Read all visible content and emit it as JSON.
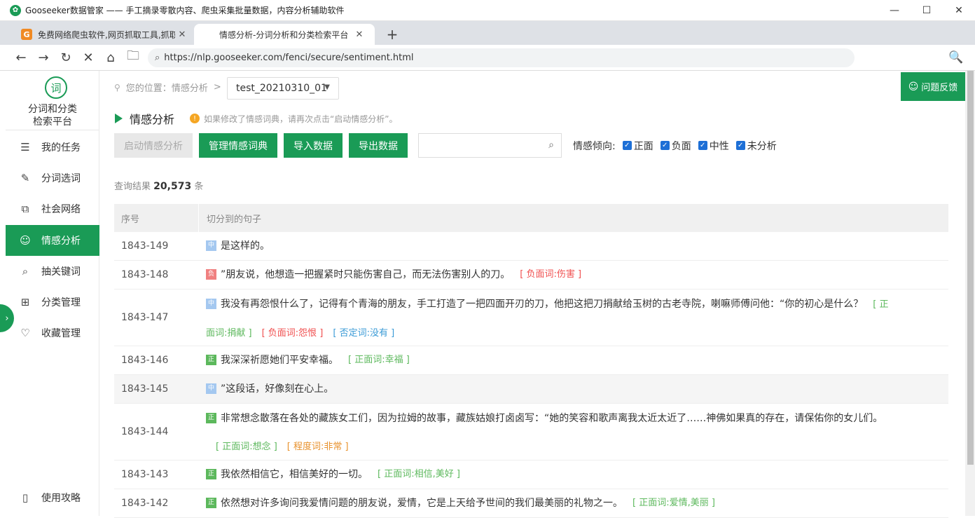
{
  "window": {
    "title": "Gooseeker数据管家 —— 手工摘录零散内容、爬虫采集批量数据，内容分析辅助软件",
    "min_glyph": "—",
    "max_glyph": "☐",
    "close_glyph": "✕"
  },
  "tabs": [
    {
      "favicon": "G",
      "title": "免费网络爬虫软件,网页抓取工具,抓取",
      "close": "✕"
    },
    {
      "title": "情感分析-分词分析和分类检索平台",
      "close": "✕"
    }
  ],
  "new_tab_glyph": "+",
  "nav": {
    "back": "←",
    "forward": "→",
    "reload": "↻",
    "stop": "✕",
    "home": "⌂",
    "folder": "🗀",
    "url": "https://nlp.gooseeker.com/fenci/secure/sentiment.html",
    "search_glyph": "🔍"
  },
  "sidebar": {
    "logo_char": "词",
    "title_line1": "分词和分类",
    "title_line2": "检索平台",
    "items": [
      {
        "label": "我的任务",
        "icon": "☰"
      },
      {
        "label": "分词选词",
        "icon": "✎"
      },
      {
        "label": "社会网络",
        "icon": "⧉"
      },
      {
        "label": "情感分析",
        "icon": "☺"
      },
      {
        "label": "抽关键词",
        "icon": "⌕"
      },
      {
        "label": "分类管理",
        "icon": "⊞"
      },
      {
        "label": "收藏管理",
        "icon": "♡"
      }
    ],
    "bottom_item": {
      "label": "使用攻略",
      "icon": "▯"
    },
    "toggle_glyph": "›"
  },
  "breadcrumb": {
    "prefix": "您的位置：",
    "current": "情感分析",
    "arrow": ">"
  },
  "project_select": {
    "value": "test_20210310_01"
  },
  "feedback_button": "问题反馈",
  "section": {
    "title": "情感分析",
    "hint_icon": "!",
    "hint": "如果修改了情感词典，请再次点击“启动情感分析”。"
  },
  "toolbar": {
    "start_button": "启动情感分析",
    "manage_button": "管理情感词典",
    "import_button": "导入数据",
    "export_button": "导出数据",
    "search_placeholder": "",
    "filter_label": "情感倾向:",
    "filters": [
      {
        "label": "正面",
        "checked": true
      },
      {
        "label": "负面",
        "checked": true
      },
      {
        "label": "中性",
        "checked": true
      },
      {
        "label": "未分析",
        "checked": true
      }
    ]
  },
  "results": {
    "label": "查询结果",
    "count": "20,573",
    "unit": "条"
  },
  "table": {
    "col_no": "序号",
    "col_sentence": "切分到的句子",
    "rows": [
      {
        "no": "1843-149",
        "tag": "中",
        "text": "是这样的。",
        "keywords": []
      },
      {
        "no": "1843-148",
        "tag": "负",
        "text": "”朋友说，他想造一把握紧时只能伤害自己，而无法伤害别人的刀。",
        "keywords": [
          "[ 负面词:伤害 ]"
        ]
      },
      {
        "no": "1843-147",
        "tag": "中",
        "text": "我没有再怨恨什么了，记得有个青海的朋友，手工打造了一把四面开刃的刀，他把这把刀捐献给玉树的古老寺院，喇嘛师傅问他：“你的初心是什么？",
        "keywords": [
          "[ 正",
          "面词:捐献 ]",
          "[ 负面词:怨恨 ]",
          "[ 否定词:没有 ]"
        ]
      },
      {
        "no": "1843-146",
        "tag": "正",
        "text": "我深深祈愿她们平安幸福。",
        "keywords": [
          "[ 正面词:幸福 ]"
        ]
      },
      {
        "no": "1843-145",
        "tag": "中",
        "text": "”这段话，好像刻在心上。",
        "keywords": []
      },
      {
        "no": "1843-144",
        "tag": "正",
        "text": "非常想念散落在各处的藏族女工们，因为拉姆的故事，藏族姑娘打卤卤写：“她的笑容和歌声离我太近太近了……神佛如果真的存在，请保佑你的女儿们。",
        "keywords": [
          "[ 正面词:想念 ]",
          "[ 程度词:非常 ]"
        ]
      },
      {
        "no": "1843-143",
        "tag": "正",
        "text": "我依然相信它，相信美好的一切。",
        "keywords": [
          "[ 正面词:相信,美好 ]"
        ]
      },
      {
        "no": "1843-142",
        "tag": "正",
        "text": "依然想对许多询问我爱情问题的朋友说，爱情，它是上天给予世间的我们最美丽的礼物之一。",
        "keywords": [
          "[ 正面词:爱情,美丽 ]"
        ]
      }
    ]
  }
}
